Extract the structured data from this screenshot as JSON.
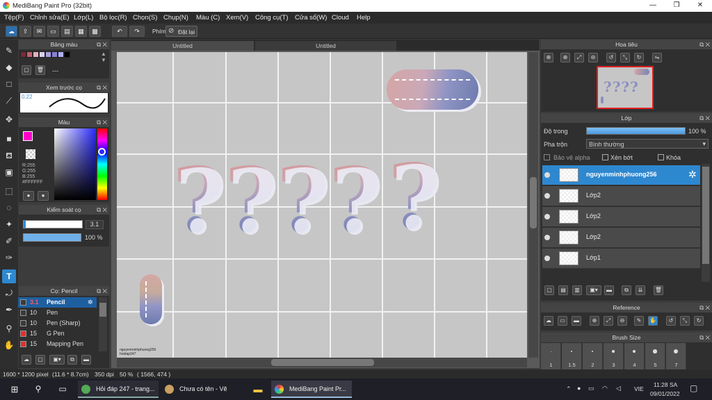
{
  "window": {
    "title": "MediBang Paint Pro (32bit)",
    "minimize": "—",
    "maximize": "❐",
    "close": "✕"
  },
  "menu": [
    "Tệp(F)",
    "Chỉnh sửa(E)",
    "Lớp(L)",
    "Bộ lọc(R)",
    "Chọn(S)",
    "Chụp(N)",
    "Màu (C)",
    "Xem(V)",
    "Công cụ(T)",
    "Cửa sổ(W)",
    "Cloud",
    "Help"
  ],
  "toolbar": {
    "shortcut_label": "Phím",
    "reset_label": "Đặt lại"
  },
  "palette_panel": {
    "title": "Bảng màu",
    "dash": "---",
    "colors": [
      "#7a2a3a",
      "#c06070",
      "#e0b0c0",
      "#d8d0f0",
      "#a8a0e0",
      "#8880d8",
      "#b0b0f0",
      "#000000"
    ]
  },
  "brush_preview": {
    "title": "Xem trước cọ",
    "size": "0.22"
  },
  "color_panel": {
    "title": "Màu",
    "r": "R:255",
    "g": "G:255",
    "b": "B:255",
    "hex": "#FFFFFF",
    "foreground": "#ff00cc",
    "background": "#ffffff"
  },
  "brush_control": {
    "title": "Kiểm soát cọ",
    "size_value": "3.1",
    "opacity_value": "100 %"
  },
  "brush_list": {
    "title": "Cọ: Pencil",
    "items": [
      {
        "size": "3.1",
        "name": "Pencil",
        "color": "#3a3a3a"
      },
      {
        "size": "10",
        "name": "Pen",
        "color": "#3a3a3a"
      },
      {
        "size": "10",
        "name": "Pen (Sharp)",
        "color": "#3a3a3a"
      },
      {
        "size": "15",
        "name": "G Pen",
        "color": "#e03030"
      },
      {
        "size": "15",
        "name": "Mapping Pen",
        "color": "#e03030"
      }
    ]
  },
  "tabs": [
    "Untitled",
    "Untitled"
  ],
  "canvas": {
    "signature_line1": "nguyenminhphuong256",
    "signature_line2": "hoidap247",
    "question_mark": "?"
  },
  "navigator": {
    "title": "Hoa tiêu"
  },
  "layer_panel": {
    "title": "Lớp",
    "opacity_label": "Độ trong",
    "opacity_value": "100 %",
    "opacity_fraction": 1.0,
    "blend_label": "Pha trộn",
    "blend_value": "Bình thường",
    "protect_alpha": "Bảo vệ alpha",
    "clipping": "Xén bớt",
    "lock": "Khóa",
    "layers": [
      {
        "name": "nguyenminhphuong256",
        "selected": true
      },
      {
        "name": "Lớp2",
        "selected": false
      },
      {
        "name": "Lớp2",
        "selected": false
      },
      {
        "name": "Lớp2",
        "selected": false
      },
      {
        "name": "Lớp1",
        "selected": false
      }
    ]
  },
  "reference_panel": {
    "title": "Reference"
  },
  "brush_size_panel": {
    "title": "Brush Size",
    "sizes": [
      "1",
      "1.5",
      "2",
      "3",
      "4",
      "5",
      "7"
    ]
  },
  "status": {
    "size": "1600 * 1200 pixel",
    "physical": "(11.6 * 8.7cm)",
    "dpi": "350 dpi",
    "zoom": "50 %",
    "coords": "( 1566, 474 )"
  },
  "taskbar": {
    "items": [
      "Hỏi đáp 247 - trang...",
      "Chưa có tên - Vẽ",
      "MediBang Paint Pr..."
    ],
    "lang": "VIE",
    "time": "11:28 SA",
    "date": "09/01/2022"
  }
}
